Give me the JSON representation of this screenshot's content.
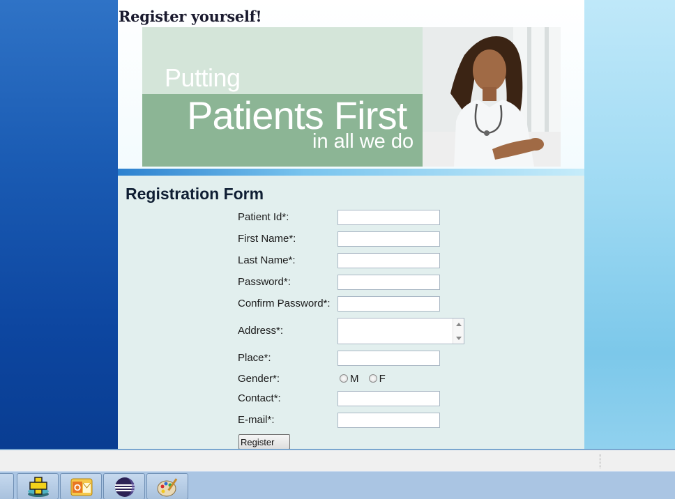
{
  "header": {
    "title": "Register yourself!"
  },
  "banner": {
    "line1": "Putting",
    "line2": "Patients First",
    "line3": "in all we do",
    "image": "nurse-photo"
  },
  "form": {
    "title": "Registration Form",
    "fields": {
      "patient_id": {
        "label": "Patient Id*:",
        "value": ""
      },
      "first_name": {
        "label": "First Name*:",
        "value": ""
      },
      "last_name": {
        "label": "Last Name*:",
        "value": ""
      },
      "password": {
        "label": "Password*:",
        "value": ""
      },
      "confirm_password": {
        "label": "Confirm Password*:",
        "value": ""
      },
      "address": {
        "label": "Address*:",
        "value": ""
      },
      "place": {
        "label": "Place*:",
        "value": ""
      },
      "gender": {
        "label": "Gender*:",
        "options": [
          "M",
          "F"
        ]
      },
      "contact": {
        "label": "Contact*:",
        "value": ""
      },
      "email": {
        "label": "E-mail*:",
        "value": ""
      }
    },
    "register_label": "Register"
  },
  "taskbar": {
    "apps": [
      "hospital-app-icon",
      "outlook-icon",
      "eclipse-icon",
      "paint-icon"
    ]
  },
  "colors": {
    "banner_light": "#d4e5d9",
    "banner_band": "#8cb595",
    "form_bg": "#e2efee",
    "title_color": "#0f1e33"
  }
}
